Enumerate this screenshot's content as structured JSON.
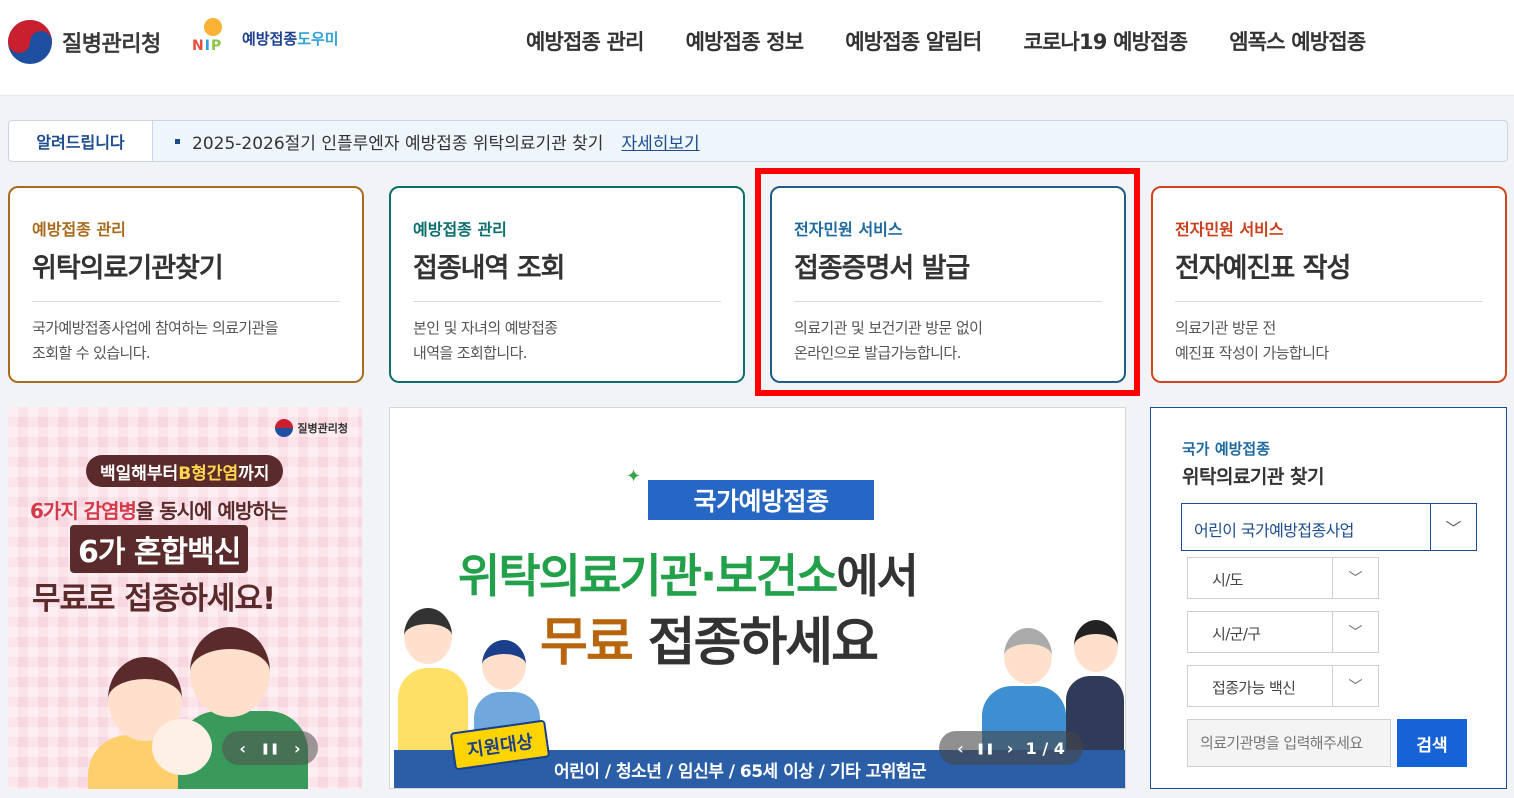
{
  "header": {
    "org_name": "질병관리청",
    "nip_logo_text_a": "예방접종",
    "nip_logo_text_b": "도우미",
    "nip_letters": [
      "N",
      "I",
      "P"
    ],
    "nav": [
      "예방접종 관리",
      "예방접종 정보",
      "예방접종 알림터",
      "코로나19 예방접종",
      "엠폭스 예방접종"
    ]
  },
  "notice": {
    "label": "알려드립니다",
    "text": "2025-2026절기 인플루엔자 예방접종 위탁의료기관 찾기",
    "link": "자세히보기"
  },
  "cards": [
    {
      "category": "예방접종 관리",
      "title": "위탁의료기관찾기",
      "desc1": "국가예방접종사업에 참여하는 의료기관을",
      "desc2": "조회할 수 있습니다.",
      "color": "#a86b1e"
    },
    {
      "category": "예방접종 관리",
      "title": "접종내역 조회",
      "desc1": "본인 및 자녀의 예방접종",
      "desc2": "내역을 조회합니다.",
      "color": "#0d6e6e"
    },
    {
      "category": "전자민원 서비스",
      "title": "접종증명서 발급",
      "desc1": "의료기관 및 보건기관 방문 없이",
      "desc2": "온라인으로 발급가능합니다.",
      "color": "#1e5d8a"
    },
    {
      "category": "전자민원 서비스",
      "title": "전자예진표 작성",
      "desc1": "의료기관 방문 전",
      "desc2": "예진표 작성이 가능합니다",
      "color": "#d2461f"
    }
  ],
  "banner_left": {
    "org": "질병관리청",
    "pill_a": "백일해부터 ",
    "pill_b": "B형간염",
    "pill_c": "까지",
    "line1_a": "6가지 감염병",
    "line1_b": "을 동시에 예방하는",
    "line2": "6가 혼합백신",
    "line3": "무료로 접종하세요!"
  },
  "banner_center": {
    "tag": "국가예방접종",
    "line1_a": "위탁의료기관·보건소",
    "line1_b": "에서",
    "line2_a": "무료",
    "line2_b": " 접종하세요",
    "badge": "지원대상",
    "bottom": "어린이 / 청소년 / 임신부 / 65세 이상 / 기타 고위험군",
    "pager": "1 / 4"
  },
  "controls": {
    "prev": "‹",
    "pause": "❚❚",
    "next": "›"
  },
  "search": {
    "sub": "국가 예방접종",
    "title": "위탁의료기관 찾기",
    "program": "어린이 국가예방접종사업",
    "sido": "시/도",
    "sigungu": "시/군/구",
    "vaccine": "접종가능 백신",
    "placeholder": "의료기관명을 입력해주세요",
    "button": "검색"
  },
  "highlight_color": "#ff0000"
}
